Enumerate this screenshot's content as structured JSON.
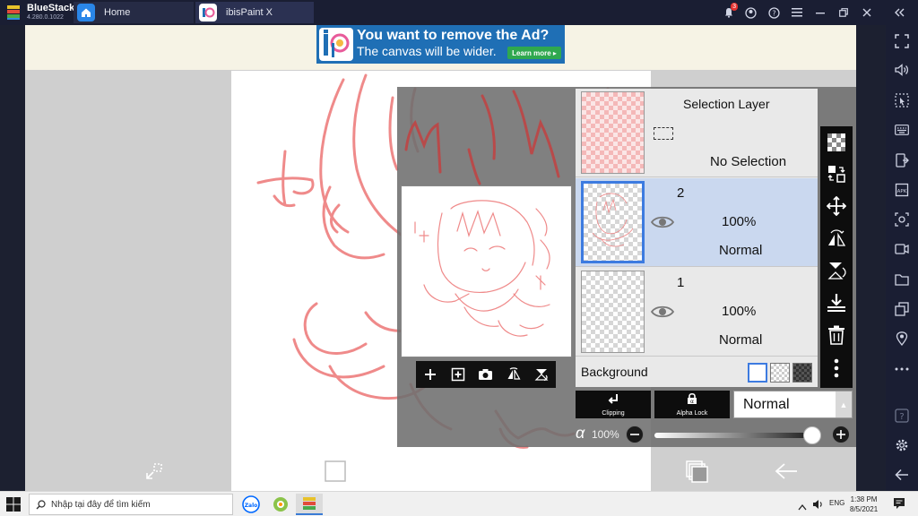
{
  "titlebar": {
    "app_name": "BlueStacks",
    "app_version": "4.280.0.1022",
    "tabs": [
      {
        "label": "Home"
      },
      {
        "label": "ibisPaint X"
      }
    ],
    "notification_count": "3"
  },
  "ad": {
    "line1": "You want to remove the Ad?",
    "line2": "The canvas will be wider.",
    "button": "Learn more ▸"
  },
  "layers": {
    "selection": {
      "name": "Selection Layer",
      "status": "No Selection"
    },
    "items": [
      {
        "number": "2",
        "opacity": "100%",
        "blend": "Normal",
        "selected": true
      },
      {
        "number": "1",
        "opacity": "100%",
        "blend": "Normal",
        "selected": false
      }
    ],
    "background_label": "Background"
  },
  "layer_controls": {
    "clipping_label": "Clipping",
    "alpha_lock_label": "Alpha Lock",
    "blend_mode": "Normal",
    "alpha_symbol": "α",
    "opacity_label": "100%",
    "opacity_fraction": 1.0
  },
  "colors": {
    "sketch_stroke": "#ef8a8a",
    "selected_layer": "#cad8ef",
    "selected_border": "#3d7be0",
    "ad_blue": "#1f6fb5",
    "learn_green": "#2fa84f"
  },
  "taskbar": {
    "search_placeholder": "Nhập tại đây để tìm kiếm",
    "language": "ENG",
    "time": "1:38 PM",
    "date": "8/5/2021"
  },
  "icons": {
    "sidebar": [
      "expand-icon",
      "volume-icon",
      "pointer-icon",
      "keyboard-icon",
      "install-apk-icon",
      "apk-icon",
      "screenshot-icon",
      "record-icon",
      "folder-icon",
      "multi-instance-icon",
      "location-icon",
      "more-icon",
      "help-icon",
      "settings-icon",
      "back-icon"
    ],
    "layer_tools": [
      "transparent-layer-icon",
      "layer-swap-icon",
      "move-icon",
      "flip-horizontal-icon",
      "flip-vertical-icon",
      "merge-down-icon",
      "trash-icon",
      "more-vertical-icon"
    ],
    "preview_tools": [
      "add-layer-icon",
      "add-special-layer-icon",
      "camera-icon",
      "flip-icon",
      "rotate-icon"
    ],
    "bottom_tools": [
      "transform-tool-icon",
      "brush-size-icon",
      "color-square-icon",
      "upload-arrow-icon",
      "undo-icon",
      "redo-icon",
      "layers-icon",
      "back-arrow-icon"
    ]
  }
}
